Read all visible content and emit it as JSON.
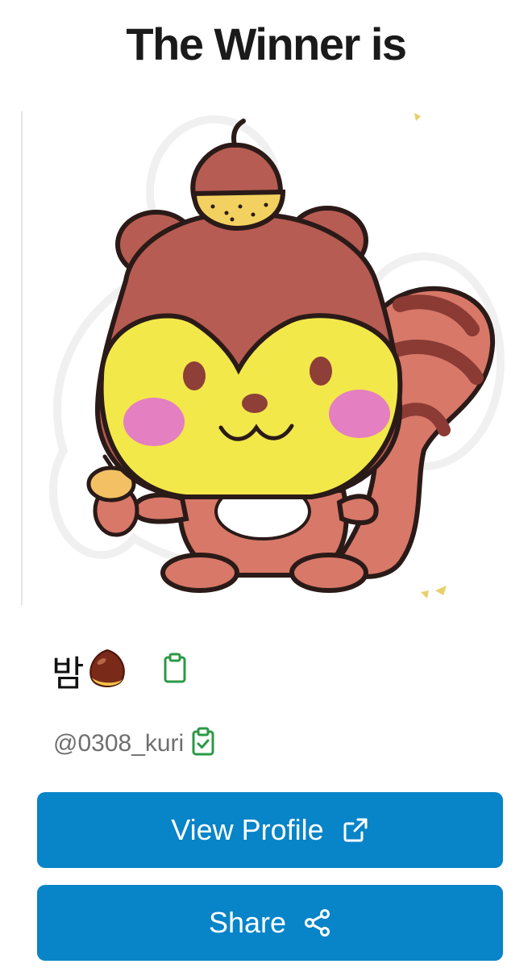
{
  "page": {
    "title": "The Winner is"
  },
  "winner": {
    "avatar_icon": "squirrel-with-chestnut-illustration",
    "display_name": "밤",
    "display_name_emoji_icon": "chestnut-emoji",
    "handle": "@0308_kuri"
  },
  "actions": {
    "view_profile_label": "View Profile",
    "view_profile_icon": "external-link-icon",
    "share_label": "Share",
    "share_icon": "share-icon"
  },
  "colors": {
    "button_blue": "#0884c8",
    "copy_icon_green": "#2a9a45",
    "handle_gray": "#6f6f6f"
  }
}
